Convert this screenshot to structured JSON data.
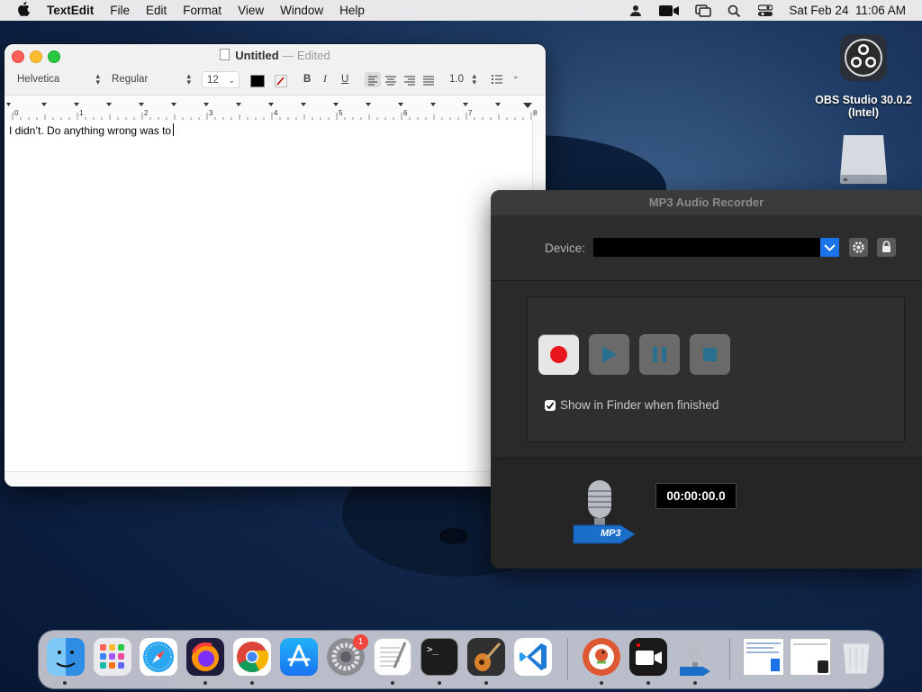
{
  "menubar": {
    "app_name": "TextEdit",
    "items": [
      "File",
      "Edit",
      "Format",
      "View",
      "Window",
      "Help"
    ],
    "datetime": "Sat Feb 24  11:06 AM"
  },
  "desktop": {
    "obs_label_line1": "OBS Studio 30.0.2",
    "obs_label_line2": "(Intel)"
  },
  "textedit": {
    "title": "Untitled",
    "edited": "— Edited",
    "font_family": "Helvetica",
    "font_style": "Regular",
    "font_size": "12",
    "line_spacing": "1.0",
    "bold": "B",
    "italic": "I",
    "underline": "U",
    "ruler_numbers": [
      "0",
      "1",
      "2",
      "3",
      "4",
      "5",
      "6",
      "7",
      "8"
    ],
    "body_text": "I didn’t. Do anything wrong was to"
  },
  "mp3": {
    "title": "MP3 Audio Recorder",
    "device_label": "Device:",
    "show_in_finder": "Show in Finder when finished",
    "show_in_finder_checked": true,
    "timer": "00:00:00.0",
    "badge": "MP3",
    "record_color": "#e8171d"
  },
  "dock": {
    "settings_badge": "1",
    "apps": [
      "finder",
      "launchpad",
      "safari",
      "firefox",
      "chrome",
      "app-store",
      "system-settings",
      "textedit",
      "terminal",
      "garageband",
      "vscode",
      "duckduckgo",
      "screen-recorder",
      "mp3-recorder"
    ]
  }
}
